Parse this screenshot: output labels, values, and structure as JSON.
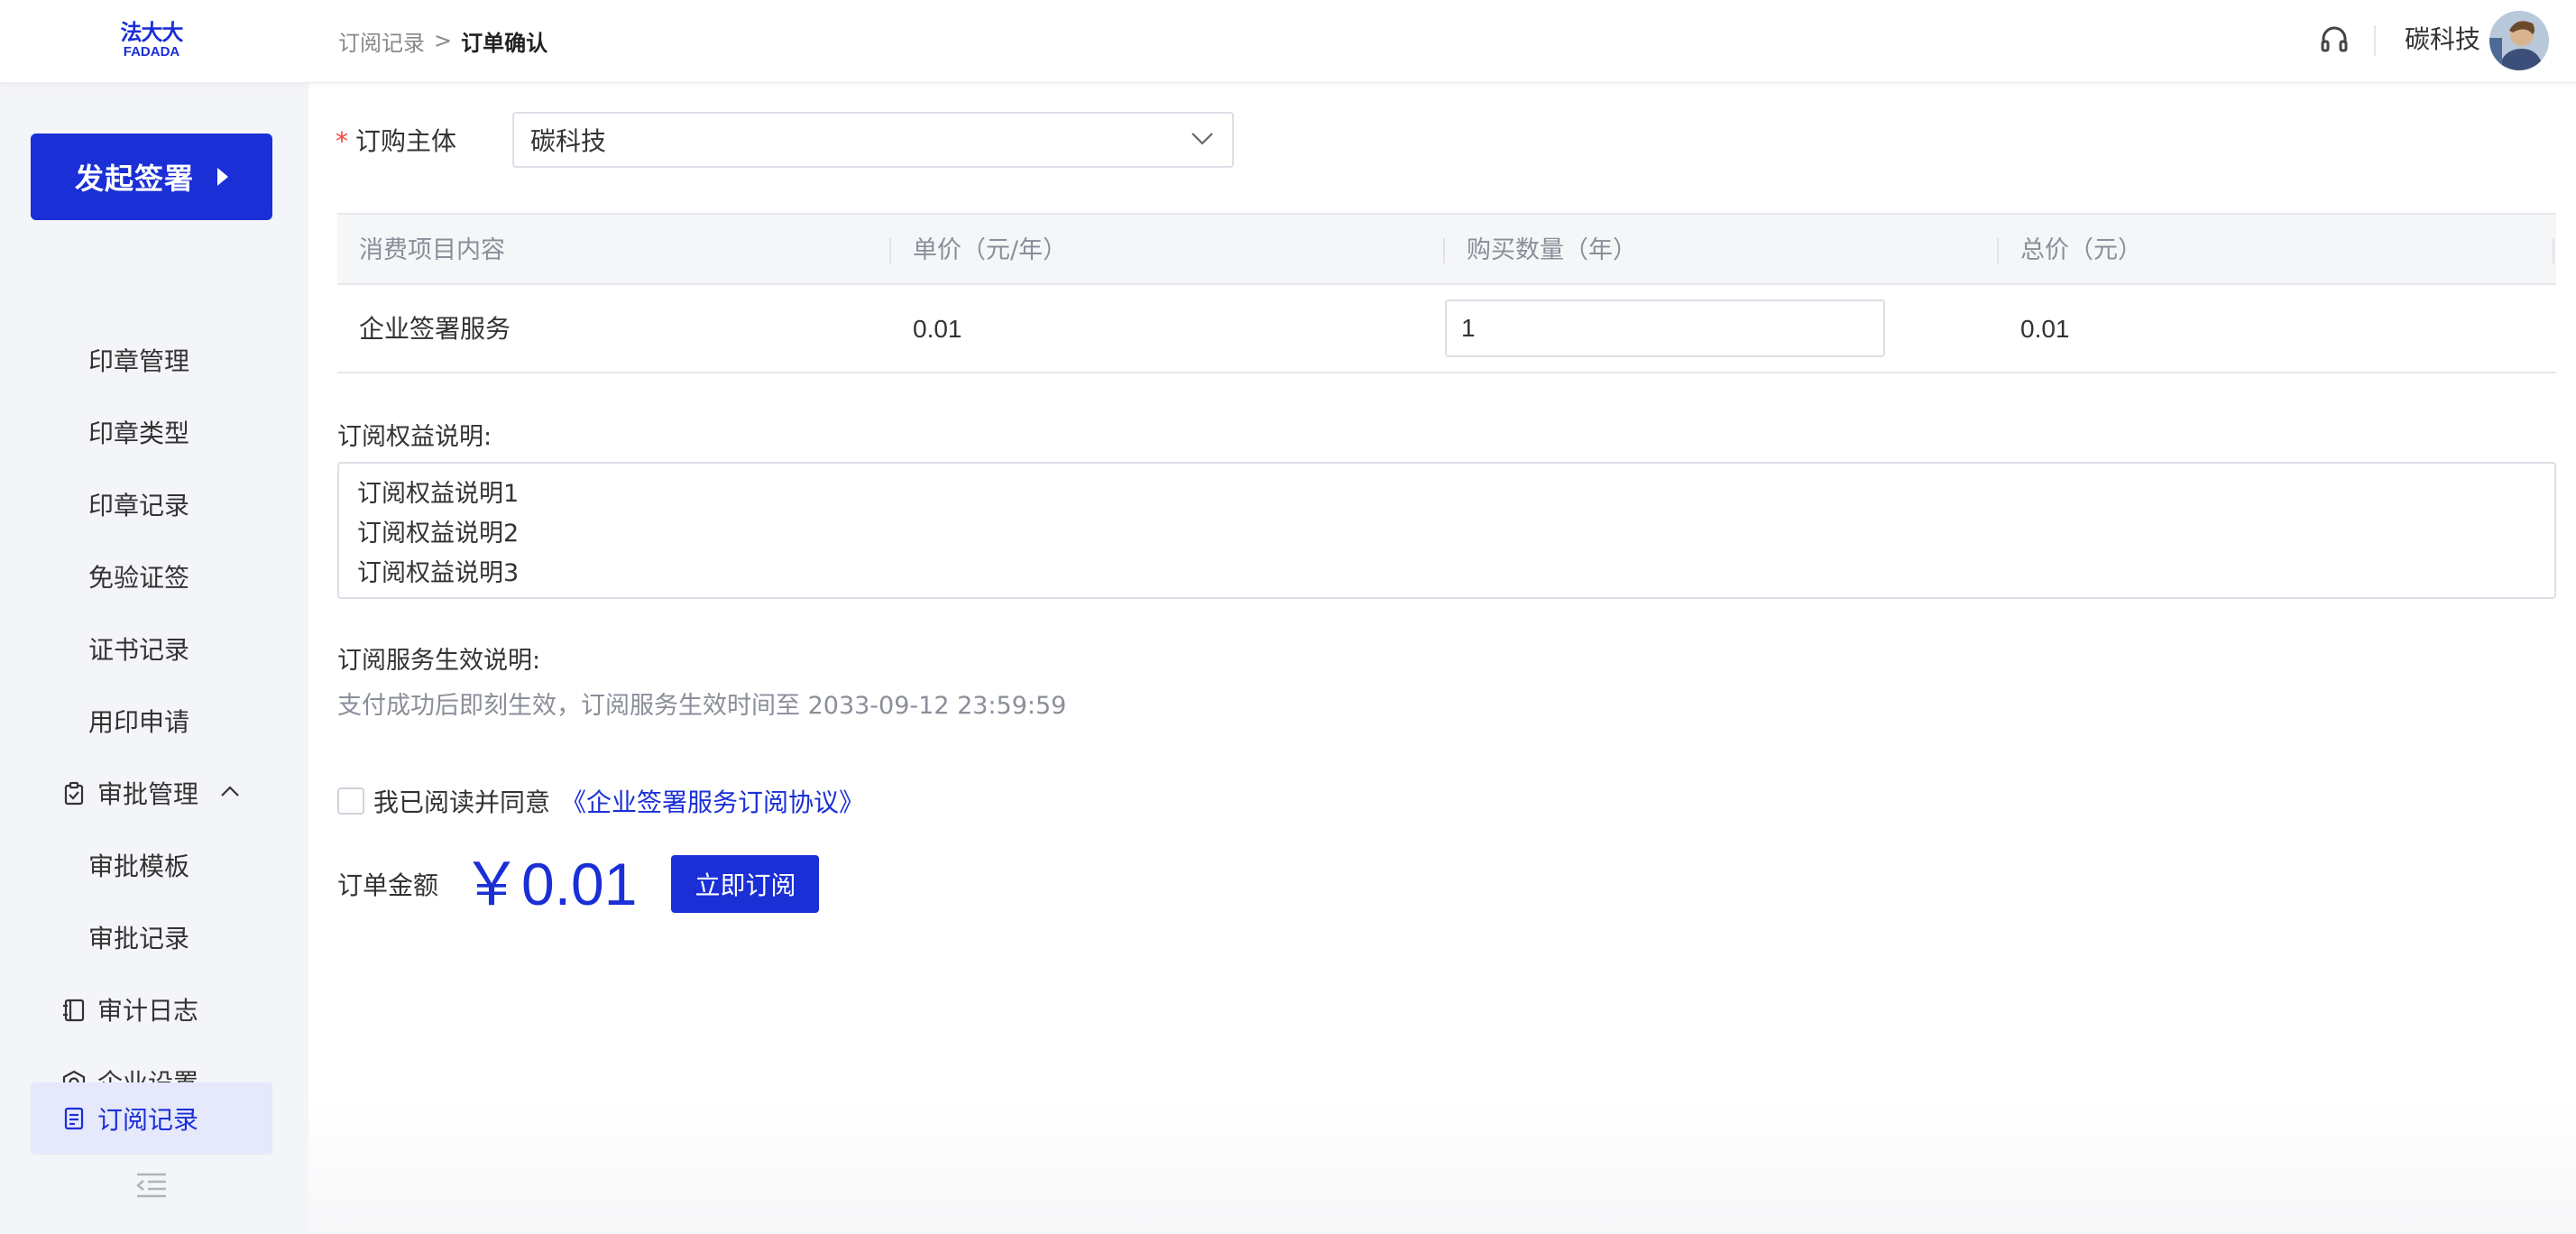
{
  "header": {
    "logo_cn": "法大大",
    "logo_en": "FADADA",
    "breadcrumb": {
      "parent": "订阅记录",
      "separator": ">",
      "current": "订单确认"
    },
    "company_name": "碳科技"
  },
  "sidebar": {
    "start_button": "发起签署",
    "items": [
      {
        "label": "印章管理"
      },
      {
        "label": "印章类型"
      },
      {
        "label": "印章记录"
      },
      {
        "label": "免验证签"
      },
      {
        "label": "证书记录"
      },
      {
        "label": "用印申请"
      },
      {
        "label": "审批管理",
        "icon": "clipboard-check-icon"
      },
      {
        "label": "审批模板"
      },
      {
        "label": "审批记录"
      },
      {
        "label": "审计日志",
        "icon": "notebook-icon"
      },
      {
        "label": "企业设置",
        "icon": "hexagon-settings-icon"
      },
      {
        "label": "订阅记录",
        "icon": "document-list-icon",
        "active": true
      }
    ]
  },
  "form": {
    "required_mark": "*",
    "subject_label": "订购主体",
    "subject_value": "碳科技"
  },
  "table": {
    "headers": [
      "消费项目内容",
      "单价（元/年）",
      "购买数量（年）",
      "总价（元）"
    ],
    "row": {
      "item": "企业签署服务",
      "unit_price": "0.01",
      "quantity": "1",
      "total": "0.01"
    }
  },
  "benefits": {
    "title": "订阅权益说明:",
    "lines": [
      "订阅权益说明1",
      "订阅权益说明2",
      "订阅权益说明3"
    ]
  },
  "effect": {
    "title": "订阅服务生效说明:",
    "description": "支付成功后即刻生效，订阅服务生效时间至 2033-09-12 23:59:59"
  },
  "agreement": {
    "text": "我已阅读并同意",
    "link": "《企业签署服务订阅协议》"
  },
  "order": {
    "label": "订单金额",
    "amount": "￥0.01",
    "subscribe_button": "立即订阅"
  },
  "colors": {
    "brand": "#1a2fd6",
    "active_bg": "#e6e8fb",
    "required": "#e8473c"
  }
}
